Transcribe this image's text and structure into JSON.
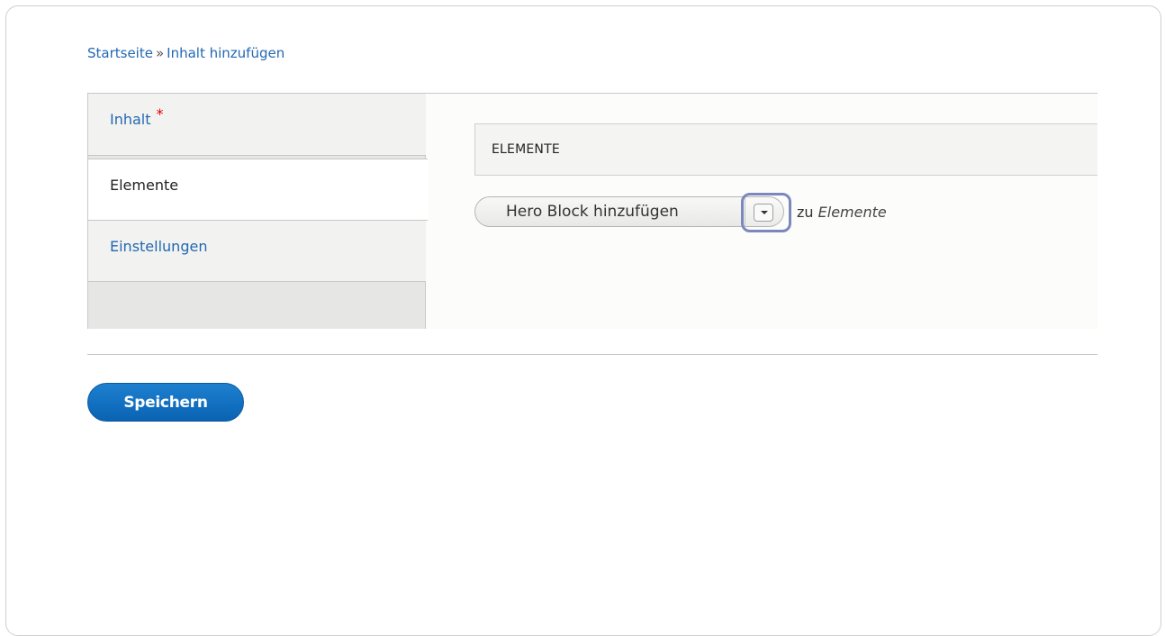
{
  "breadcrumb": {
    "home": "Startseite",
    "separator": "»",
    "current": "Inhalt hinzufügen"
  },
  "vertical_tabs": [
    {
      "label": "Inhalt",
      "required_marker": "*",
      "active": false
    },
    {
      "label": "Elemente",
      "active": true
    },
    {
      "label": "Einstellungen",
      "active": false
    }
  ],
  "pane": {
    "section_title": "ELEMENTE",
    "dropbutton": {
      "label": "Hero Block hinzufügen",
      "toggle_icon": "chevron-down-icon"
    },
    "suffix_prefix": "zu",
    "suffix_target": "Elemente"
  },
  "actions": {
    "save_label": "Speichern"
  },
  "colors": {
    "link": "#2368b3",
    "required": "#e00000",
    "primary_button": "#0a63b3",
    "focus_ring": "#7c88bd"
  }
}
